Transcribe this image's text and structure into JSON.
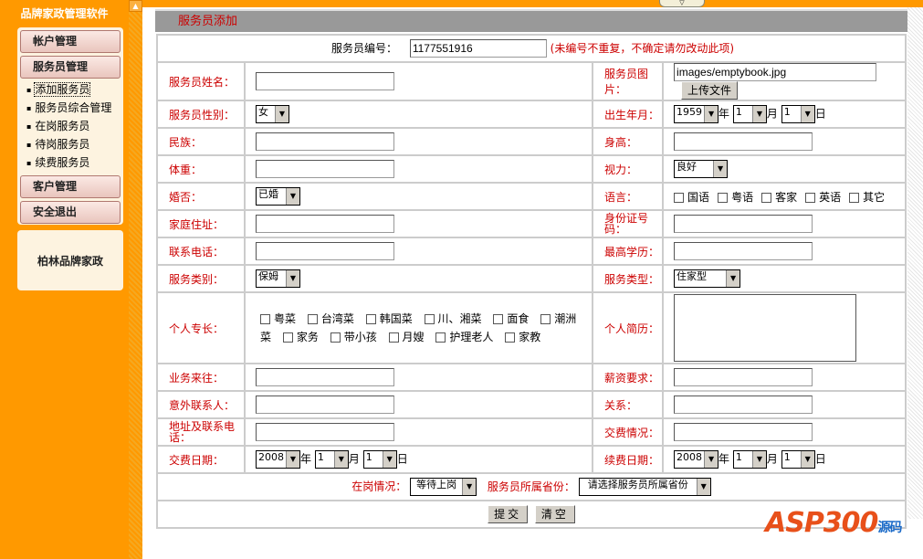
{
  "sidebar": {
    "title": "品牌家政管理软件",
    "menus": [
      "帐户管理",
      "服务员管理",
      "客户管理",
      "安全退出"
    ],
    "sub": [
      "添加服务员",
      "服务员综合管理",
      "在岗服务员",
      "待岗服务员",
      "续费服务员"
    ],
    "brand": "柏林品牌家政"
  },
  "header": {
    "title": "服务员添加"
  },
  "form": {
    "id_label": "服务员编号：",
    "id_value": "1177551916",
    "id_note": "(未编号不重复，不确定请勿改动此项)",
    "name_label": "服务员姓名：",
    "photo_label": "服务员图片：",
    "photo_value": "images/emptybook.jpg",
    "upload": "上传文件",
    "gender_label": "服务员性别：",
    "gender": "女",
    "birth_label": "出生年月：",
    "birth_year": "1959",
    "birth_month": "1",
    "birth_day": "1",
    "year": "年",
    "month": "月",
    "day": "日",
    "ethnic_label": "民族：",
    "height_label": "身高：",
    "weight_label": "体重：",
    "vision_label": "视力：",
    "vision": "良好",
    "married_label": "婚否：",
    "married": "已婚",
    "lang_label": "语言：",
    "langs": [
      "国语",
      "粤语",
      "客家",
      "英语",
      "其它"
    ],
    "address_label": "家庭住址：",
    "idcard_label": "身份证号码：",
    "phone_label": "联系电话：",
    "edu_label": "最高学历：",
    "svc_label": "服务类别：",
    "svc": "保姆",
    "svctype_label": "服务类型：",
    "svctype": "住家型",
    "skills_label": "个人专长：",
    "skills": [
      "粤菜",
      "台湾菜",
      "韩国菜",
      "川、湘菜",
      "面食",
      "潮洲菜",
      "家务",
      "带小孩",
      "月嫂",
      "护理老人",
      "家教"
    ],
    "resume_label": "个人简历：",
    "biz_label": "业务来往：",
    "salary_label": "薪资要求：",
    "emerg_label": "意外联系人：",
    "rel_label": "关系：",
    "addrphone_label": "地址及联系电话：",
    "fee_label": "交费情况：",
    "paydate_label": "交费日期：",
    "pay_year": "2008",
    "pay_month": "1",
    "pay_day": "1",
    "renew_label": "续费日期：",
    "renew_year": "2008",
    "renew_month": "1",
    "renew_day": "1",
    "status_label": "在岗情况：",
    "status": "等待上岗",
    "prov_label": "服务员所属省份：",
    "prov": "请选择服务员所属省份",
    "submit": "提交",
    "clear": "清空"
  },
  "watermark": {
    "text": "ASP300",
    "sub": "源码"
  }
}
